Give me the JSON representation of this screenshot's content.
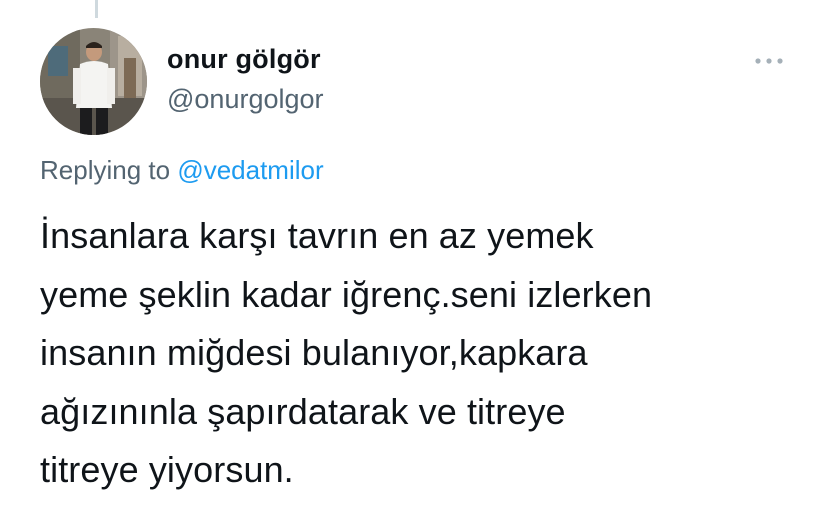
{
  "tweet": {
    "author": {
      "display_name": "onur gölgör",
      "handle": "@onurgolgor",
      "avatar_icon": "user-photo-avatar"
    },
    "more_icon": "more-dots-icon",
    "replying_to": {
      "prefix": "Replying to",
      "mention": "@vedatmilor"
    },
    "text_lines": [
      "İnsanlara karşı tavrın en az yemek",
      "yeme şeklin kadar iğrenç.seni izlerken",
      "insanın miğdesi bulanıyor,kapkara",
      "ağızınınla şapırdatarak ve titreye",
      "titreye yiyorsun."
    ]
  },
  "colors": {
    "text": "#0f1419",
    "secondary_text": "#536471",
    "link": "#1d9bf0",
    "thread_line": "#cfd9de"
  }
}
